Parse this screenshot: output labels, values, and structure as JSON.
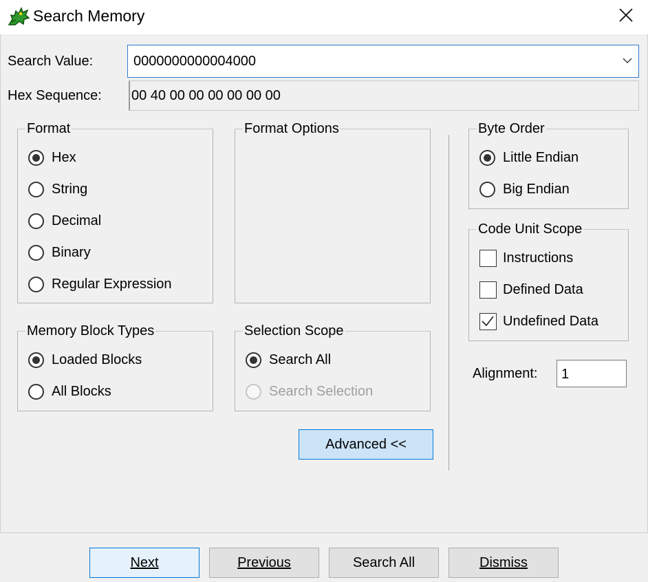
{
  "window": {
    "title": "Search Memory",
    "icon": "ghidra-dragon-icon",
    "close_icon": "close-icon"
  },
  "search_value": {
    "label": "Search Value:",
    "value": "0000000000004000",
    "dropdown_icon": "chevron-down-icon"
  },
  "hex_sequence": {
    "label": "Hex Sequence:",
    "value": "00 40 00 00 00 00 00 00"
  },
  "format": {
    "title": "Format",
    "options": [
      "Hex",
      "String",
      "Decimal",
      "Binary",
      "Regular Expression"
    ],
    "selected": "Hex"
  },
  "format_options": {
    "title": "Format Options"
  },
  "memory_block_types": {
    "title": "Memory Block Types",
    "options": [
      "Loaded Blocks",
      "All Blocks"
    ],
    "selected": "Loaded Blocks"
  },
  "selection_scope": {
    "title": "Selection Scope",
    "options": [
      "Search All",
      "Search Selection"
    ],
    "selected": "Search All",
    "disabled": [
      "Search Selection"
    ]
  },
  "byte_order": {
    "title": "Byte Order",
    "options": [
      "Little Endian",
      "Big Endian"
    ],
    "selected": "Little Endian"
  },
  "code_unit_scope": {
    "title": "Code Unit Scope",
    "options": [
      "Instructions",
      "Defined Data",
      "Undefined Data"
    ],
    "checked": [
      false,
      false,
      true
    ]
  },
  "alignment": {
    "label": "Alignment:",
    "value": "1"
  },
  "advanced_button": "Advanced <<",
  "buttons": {
    "next": "Next",
    "previous": "Previous",
    "search_all": "Search All",
    "dismiss": "Dismiss"
  },
  "colors": {
    "focus_border": "#0078d7",
    "dialog_bg": "#f0f0f0"
  }
}
